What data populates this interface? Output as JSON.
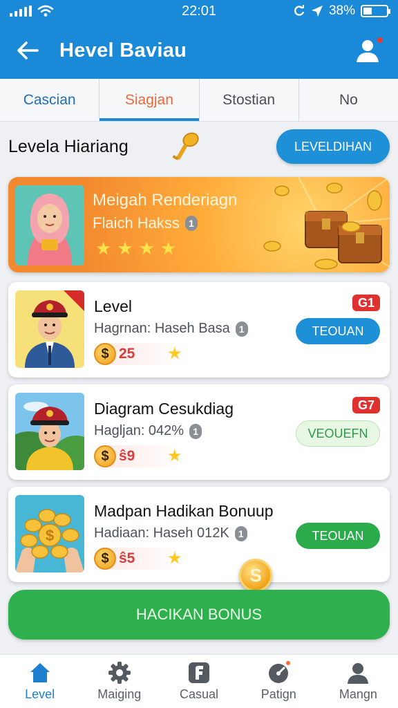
{
  "status_bar": {
    "time": "22:01",
    "battery": "38%"
  },
  "app_bar": {
    "title": "Hevel Baviau"
  },
  "tabs": [
    {
      "label": "Cascian"
    },
    {
      "label": "Siagjan"
    },
    {
      "label": "Stostian"
    },
    {
      "label": "No"
    }
  ],
  "active_tab": "Siagjan",
  "section": {
    "title": "Levela Hiariang",
    "button_label": "LEVELDIHAN"
  },
  "banner": {
    "title": "Meigah Renderiagn",
    "subtitle": "Flaich Hakss",
    "info_badge": "1",
    "star_count": 4
  },
  "cards": [
    {
      "title": "Level",
      "subtitle": "Hagrnan: Haseh Basa",
      "info_badge": "1",
      "price": "25",
      "tag": "G1",
      "button_label": "TEOUAN",
      "button_style": "blue"
    },
    {
      "title": "Diagram Cesukdiag",
      "subtitle": "Hagljan: 042%",
      "info_badge": "1",
      "price": "ŝ9",
      "tag": "G7",
      "button_label": "VEOUEFN",
      "button_style": "pale"
    },
    {
      "title": "Madpan Hadikan Bonuup",
      "subtitle": "Hadiaan: Haseh 012K",
      "info_badge": "1",
      "price": "ŝ5",
      "button_label": "TEOUAN",
      "button_style": "green"
    }
  ],
  "bonus_button": {
    "label": "HACIKAN BONUS"
  },
  "bottom_nav": [
    {
      "label": "Level",
      "icon": "home-icon",
      "active": true
    },
    {
      "label": "Maiging",
      "icon": "gear-icon"
    },
    {
      "label": "Casual",
      "icon": "f-app-icon"
    },
    {
      "label": "Patign",
      "icon": "alarm-icon",
      "badge": true
    },
    {
      "label": "Mangn",
      "icon": "user-icon"
    }
  ],
  "colors": {
    "primary": "#1a8ad8",
    "accent_orange": "#f3892f",
    "green": "#2fb04f",
    "tag_red": "#e03131"
  }
}
